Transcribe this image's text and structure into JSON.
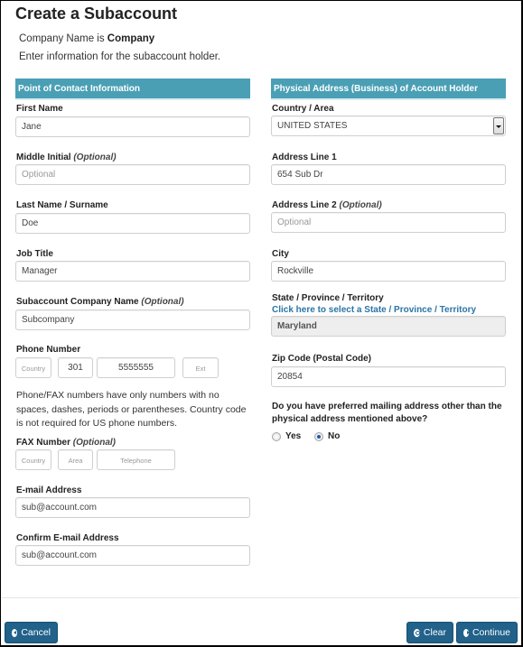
{
  "page": {
    "title": "Create a Subaccount",
    "company_prefix": "Company Name is",
    "company_name": "Company",
    "instruction": "Enter information for the subaccount holder."
  },
  "contact": {
    "heading": "Point of Contact Information",
    "first_name": {
      "label": "First Name",
      "value": "Jane"
    },
    "middle_initial": {
      "label": "Middle Initial",
      "optional": "(Optional)",
      "placeholder": "Optional"
    },
    "last_name": {
      "label": "Last Name / Surname",
      "value": "Doe"
    },
    "job_title": {
      "label": "Job Title",
      "value": "Manager"
    },
    "company_name": {
      "label": "Subaccount Company Name",
      "optional": "(Optional)",
      "value": "Subcompany"
    },
    "phone": {
      "label": "Phone Number",
      "country_placeholder": "Country",
      "area": "301",
      "number": "5555555",
      "ext_placeholder": "Ext"
    },
    "phone_note": "Phone/FAX numbers have only numbers with no spaces, dashes, periods or parentheses. Country code is not required for US phone numbers.",
    "fax": {
      "label": "FAX Number",
      "optional": "(Optional)",
      "country_placeholder": "Country",
      "area_placeholder": "Area",
      "telephone_placeholder": "Telephone"
    },
    "email": {
      "label": "E-mail Address",
      "value": "sub@account.com"
    },
    "confirm_email": {
      "label": "Confirm E-mail Address",
      "value": "sub@account.com"
    }
  },
  "address": {
    "heading": "Physical Address (Business) of Account Holder",
    "country": {
      "label": "Country / Area",
      "selected": "UNITED STATES"
    },
    "line1": {
      "label": "Address Line 1",
      "value": "654 Sub Dr"
    },
    "line2": {
      "label": "Address Line 2",
      "optional": "(Optional)",
      "placeholder": "Optional"
    },
    "city": {
      "label": "City",
      "value": "Rockville"
    },
    "state": {
      "label": "State / Province / Territory",
      "link": "Click here to select a State / Province / Territory",
      "value": "Maryland"
    },
    "zip": {
      "label": "Zip Code (Postal Code)",
      "value": "20854"
    },
    "mailing_question": "Do you have preferred mailing address other than the physical address mentioned above?",
    "mailing_options": [
      {
        "label": "Yes",
        "checked": false
      },
      {
        "label": "No",
        "checked": true
      }
    ]
  },
  "footer": {
    "cancel": "Cancel",
    "clear": "Clear",
    "continue": "Continue"
  },
  "colors": {
    "section_header": "#4a9fb5",
    "button": "#21618a",
    "link": "#2b74a6"
  }
}
